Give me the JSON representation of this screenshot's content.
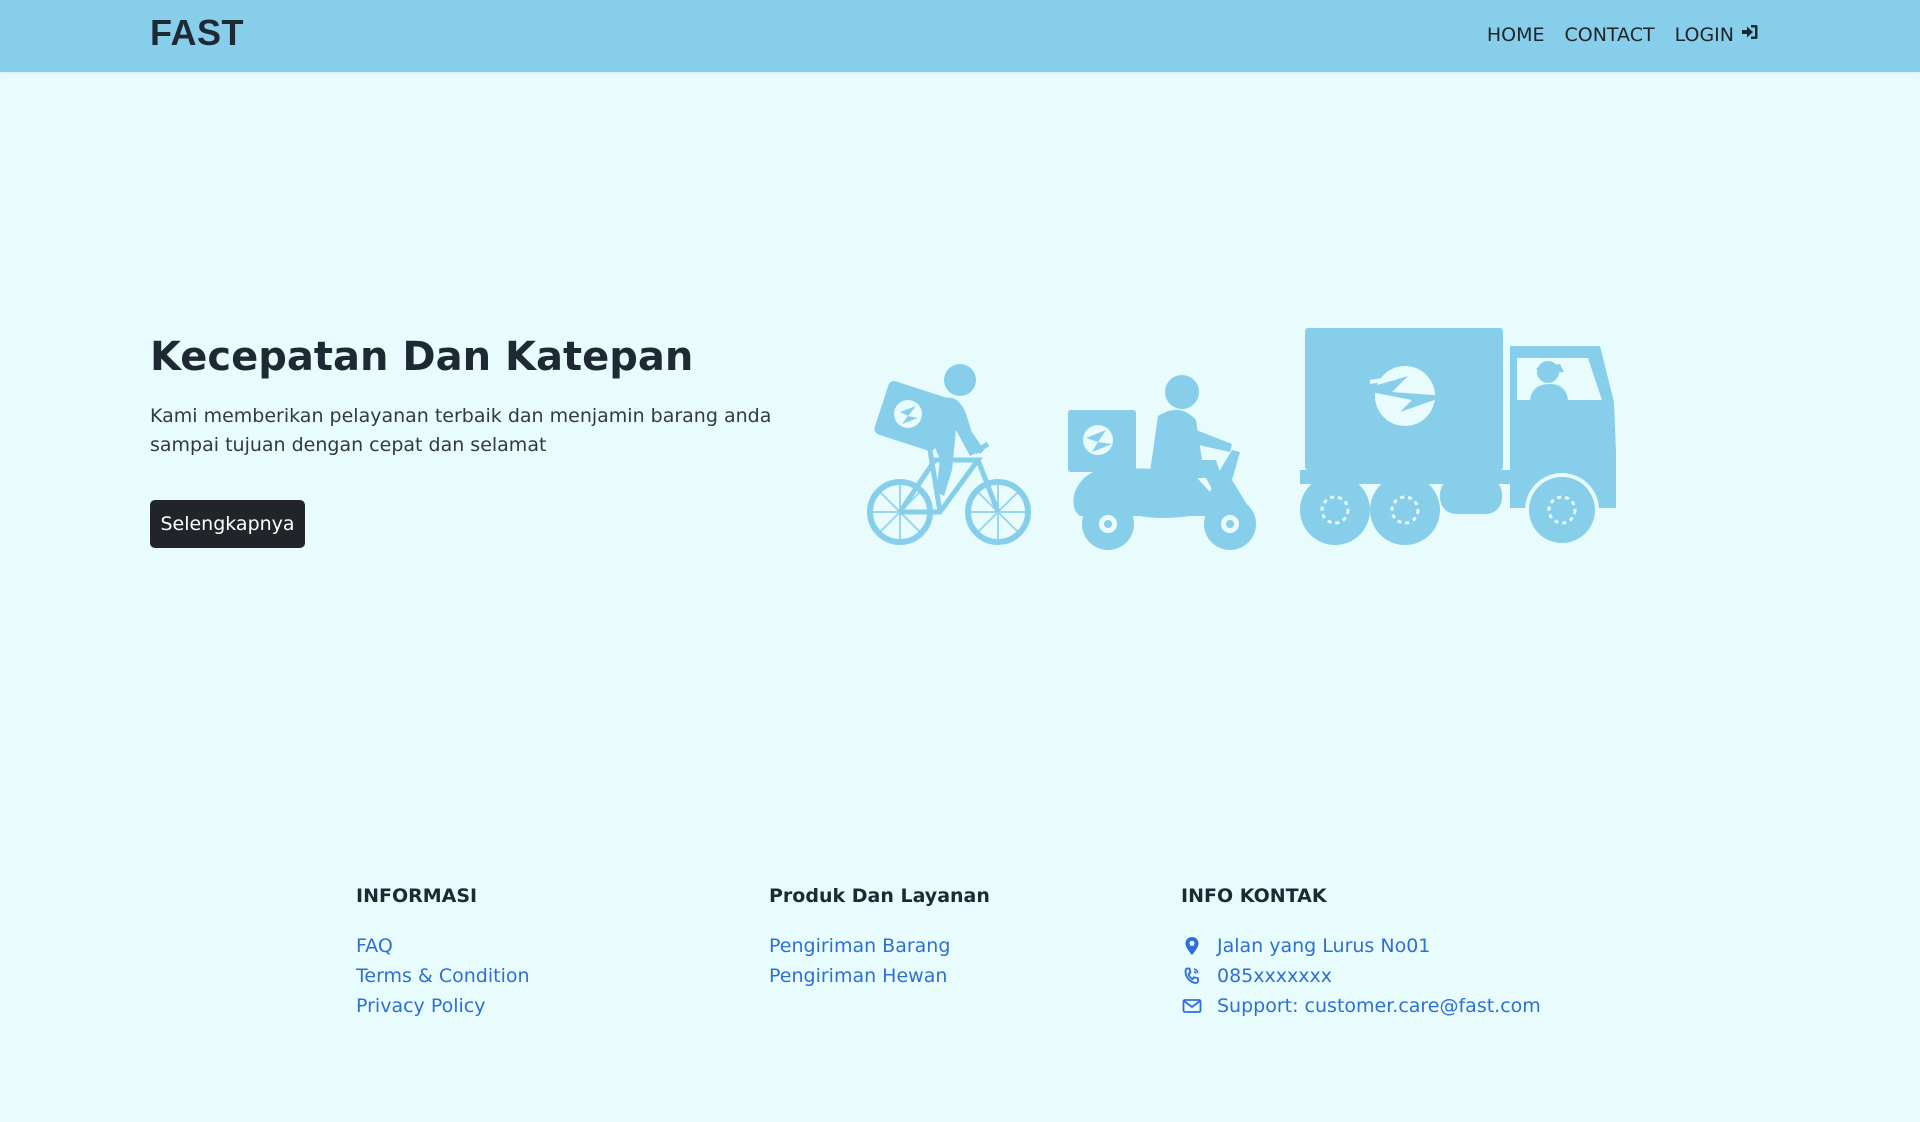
{
  "navbar": {
    "brand": "FAST",
    "links": [
      {
        "label": "HOME"
      },
      {
        "label": "CONTACT"
      },
      {
        "label": "LOGIN",
        "icon": "login-icon"
      }
    ],
    "background": "#87ceeb"
  },
  "hero": {
    "title": "Kecepatan Dan Katepan",
    "description": "Kami memberikan pelayanan terbaik dan menjamin barang anda sampai tujuan dengan cepat dan selamat",
    "button_label": "Selengkapnya",
    "illustration": "delivery-vehicles-illustration",
    "illustration_color": "#87ceeb"
  },
  "footer": {
    "informasi": {
      "heading": "INFORMASI",
      "links": [
        "FAQ",
        "Terms & Condition",
        "Privacy Policy"
      ]
    },
    "produk": {
      "heading": "Produk Dan Layanan",
      "links": [
        "Pengiriman Barang",
        "Pengiriman Hewan"
      ]
    },
    "kontak": {
      "heading": "INFO KONTAK",
      "items": [
        {
          "icon": "map-pin-icon",
          "text": "Jalan yang Lurus No01"
        },
        {
          "icon": "phone-icon",
          "text": "085xxxxxxx"
        },
        {
          "icon": "envelope-icon",
          "text": "Support: customer.care@fast.com"
        }
      ]
    },
    "link_color": "#2f6fd4"
  },
  "colors": {
    "page_background": "#e8fcfd",
    "button_background": "#212529"
  }
}
